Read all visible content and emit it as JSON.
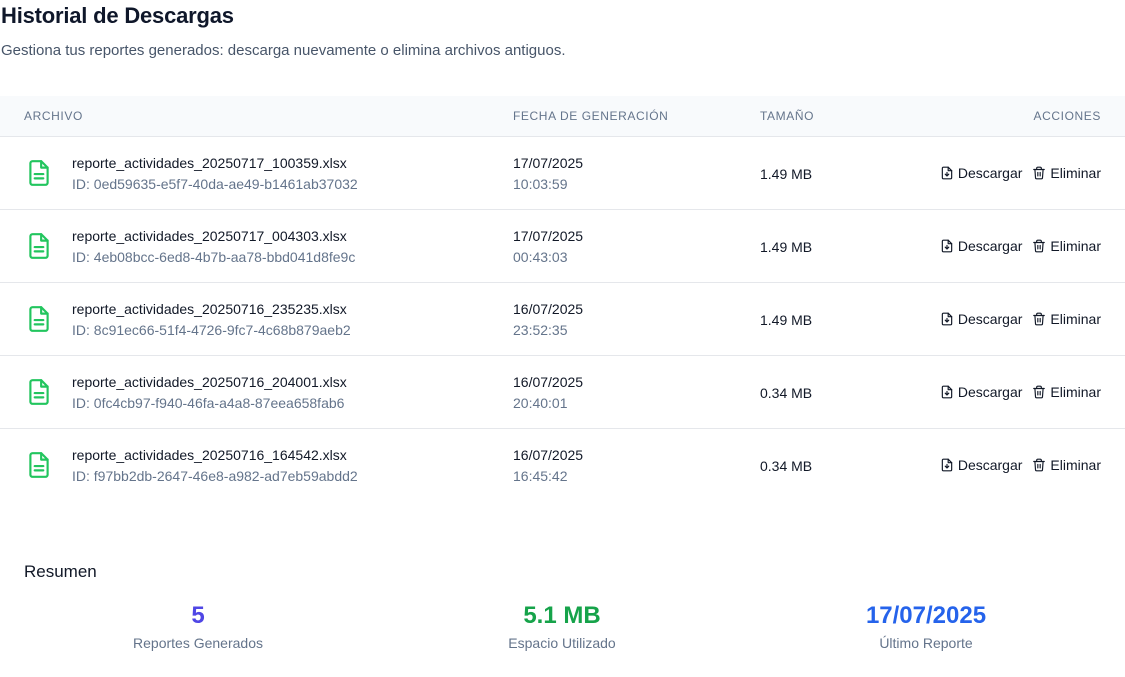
{
  "header": {
    "title": "Historial de Descargas",
    "subtitle": "Gestiona tus reportes generados: descarga nuevamente o elimina archivos antiguos."
  },
  "table": {
    "columns": {
      "file": "ARCHIVO",
      "date": "FECHA DE GENERACIÓN",
      "size": "TAMAÑO",
      "actions": "ACCIONES"
    },
    "download_label": "Descargar",
    "delete_label": "Eliminar",
    "rows": [
      {
        "name": "reporte_actividades_20250717_100359.xlsx",
        "id": "ID: 0ed59635-e5f7-40da-ae49-b1461ab37032",
        "date": "17/07/2025",
        "time": "10:03:59",
        "size": "1.49 MB"
      },
      {
        "name": "reporte_actividades_20250717_004303.xlsx",
        "id": "ID: 4eb08bcc-6ed8-4b7b-aa78-bbd041d8fe9c",
        "date": "17/07/2025",
        "time": "00:43:03",
        "size": "1.49 MB"
      },
      {
        "name": "reporte_actividades_20250716_235235.xlsx",
        "id": "ID: 8c91ec66-51f4-4726-9fc7-4c68b879aeb2",
        "date": "16/07/2025",
        "time": "23:52:35",
        "size": "1.49 MB"
      },
      {
        "name": "reporte_actividades_20250716_204001.xlsx",
        "id": "ID: 0fc4cb97-f940-46fa-a4a8-87eea658fab6",
        "date": "16/07/2025",
        "time": "20:40:01",
        "size": "0.34 MB"
      },
      {
        "name": "reporte_actividades_20250716_164542.xlsx",
        "id": "ID: f97bb2db-2647-46e8-a982-ad7eb59abdd2",
        "date": "16/07/2025",
        "time": "16:45:42",
        "size": "0.34 MB"
      }
    ]
  },
  "summary": {
    "title": "Resumen",
    "stats": [
      {
        "value": "5",
        "label": "Reportes Generados",
        "color": "#4f46e5"
      },
      {
        "value": "5.1 MB",
        "label": "Espacio Utilizado",
        "color": "#16a34a"
      },
      {
        "value": "17/07/2025",
        "label": "Último Reporte",
        "color": "#2563eb"
      }
    ]
  },
  "icons": {
    "file": "file-spreadsheet-icon",
    "download": "file-download-icon",
    "delete": "trash-icon"
  },
  "colors": {
    "file_icon": "#22c55e",
    "header_bg": "#f8fafc",
    "muted_text": "#64748b"
  }
}
